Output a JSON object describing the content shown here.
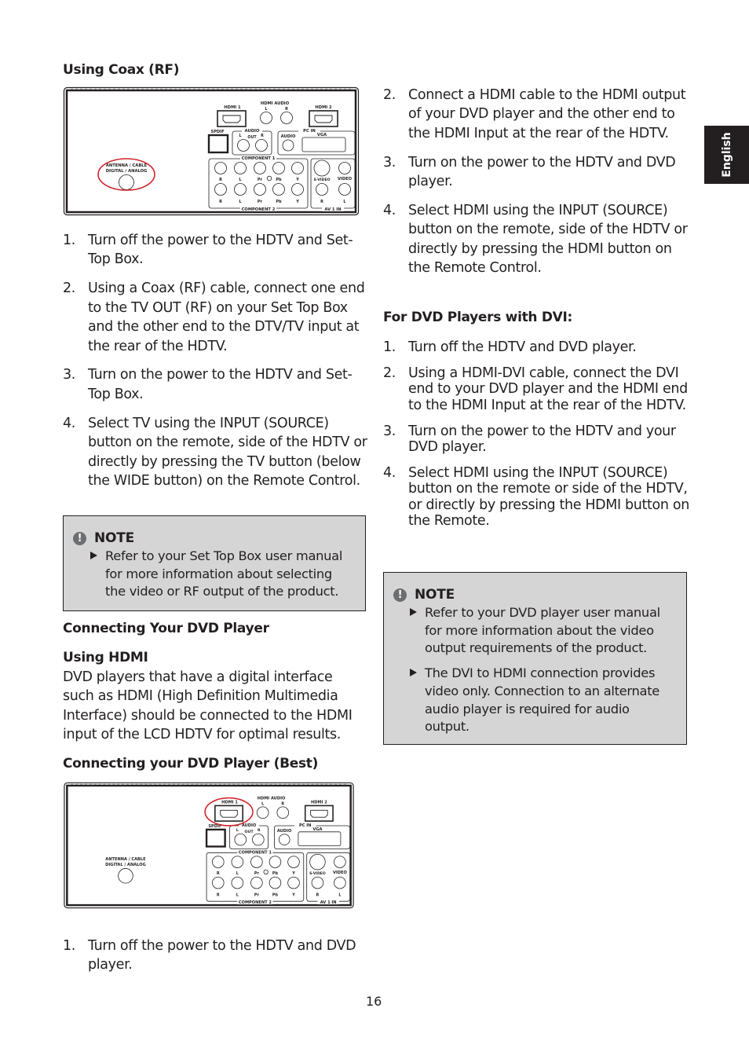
{
  "side_tab": {
    "label": "English"
  },
  "left": {
    "coax_heading": "Using Coax (RF)",
    "coax_steps": [
      {
        "num": "1.",
        "text": "Turn off the power to the HDTV and Set-Top Box."
      },
      {
        "num": "2.",
        "text": "Using a Coax (RF) cable, connect one end to the TV OUT (RF) on your Set Top Box and the other end to the DTV/TV input at the rear of the HDTV."
      },
      {
        "num": "3.",
        "text": "Turn on the power to the HDTV and Set-Top Box."
      },
      {
        "num": "4.",
        "text": "Select TV using the INPUT (SOURCE) button on the remote, side of the HDTV or directly by pressing the TV button (below the WIDE button) on the Remote Control."
      }
    ],
    "note1": {
      "title": "NOTE",
      "items": [
        "Refer to your Set Top Box user manual for more information about selecting the video or RF output of the product."
      ]
    },
    "dvd_heading": "Connecting Your DVD Player",
    "hdmi_heading": "Using HDMI",
    "hdmi_paragraph": "DVD players that have a digital interface such as HDMI (High Definition Multimedia Interface) should be connected to the HDMI input of the LCD HDTV for optimal results.",
    "best_heading": "Connecting your DVD Player (Best)",
    "best_steps": [
      {
        "num": "1.",
        "text": "Turn off the power to the HDTV and DVD player."
      }
    ]
  },
  "panel_labels": {
    "hdmi1": "HDMI 1",
    "hdmi2": "HDMI 2",
    "hdmi_audio": "HDMI  AUDIO",
    "l": "L",
    "r": "R",
    "spdif": "SPDIF",
    "audio": "AUDIO",
    "out": "OUT",
    "pc_in": "PC   IN",
    "vga": "VGA",
    "antenna_line1": "ANTENNA / CABLE",
    "antenna_line2": "DIGITAL / ANALOG",
    "component1": "COMPONENT 1",
    "component2": "COMPONENT 2",
    "pr": "Pr",
    "pb": "Pb",
    "y": "Y",
    "svideo": "S-VIDEO",
    "video": "VIDEO",
    "av1in": "AV 1 IN"
  },
  "highlight_color": "#d2232a",
  "right": {
    "hdmi_steps": [
      {
        "num": "2.",
        "text": "Connect a HDMI cable to the HDMI output of your DVD player and the other end to the HDMI Input at the rear of the HDTV."
      },
      {
        "num": "3.",
        "text": "Turn on the power to the HDTV and DVD player."
      },
      {
        "num": "4.",
        "text": "Select HDMI using the INPUT (SOURCE) button on the remote, side of the HDTV or directly by pressing the HDMI button on the Remote Control."
      }
    ],
    "dvi_heading": "For DVD Players with DVI:",
    "dvi_steps": [
      {
        "num": "1.",
        "text": "Turn off the HDTV and DVD player."
      },
      {
        "num": "2.",
        "text": "Using a HDMI-DVI cable, connect the DVI end to your DVD player and the HDMI end to the HDMI Input at the rear of the HDTV."
      },
      {
        "num": "3.",
        "text": "Turn on the power to the HDTV and your DVD player."
      },
      {
        "num": "4.",
        "text": "Select HDMI using the INPUT (SOURCE) button on the remote or side of the HDTV, or directly by pressing the HDMI button on the Remote."
      }
    ],
    "note2": {
      "title": "NOTE",
      "items": [
        "Refer to your DVD player user manual for more information about the video output requirements of the product.",
        "The DVI to HDMI connection provides video only. Connection to an alternate audio player is required for audio output."
      ]
    }
  },
  "page_number": "16"
}
